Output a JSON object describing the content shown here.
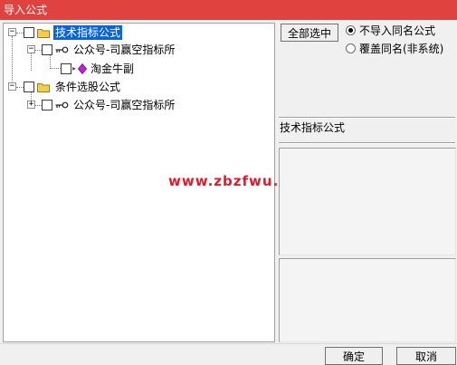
{
  "window": {
    "title": "导入公式"
  },
  "tree": {
    "groups": [
      {
        "label": "技术指标公式",
        "expander": "−",
        "selected": true,
        "children": [
          {
            "label": "公众号-司赢空指标所",
            "expander": "−",
            "icon": "key-icon",
            "children": [
              {
                "label": "淘金牛副",
                "icon": "diamond-icon"
              }
            ]
          }
        ]
      },
      {
        "label": "条件选股公式",
        "expander": "−",
        "selected": false,
        "children": [
          {
            "label": "公众号-司赢空指标所",
            "expander": "+",
            "icon": "key-icon"
          }
        ]
      }
    ]
  },
  "right_panel": {
    "select_all_label": "全部选中",
    "radio_options": [
      {
        "label": "不导入同名公式",
        "checked": true
      },
      {
        "label": "覆盖同名(非系统)",
        "checked": false
      }
    ],
    "formula_name": "技术指标公式"
  },
  "buttons": {
    "ok_label": "确定",
    "cancel_label": "取消"
  },
  "watermark": "www.zbzfwu.com",
  "colors": {
    "titlebar": "#e0423f",
    "selection": "#0a64d6",
    "watermark": "#e5192a",
    "folder": "#f2cd4f",
    "diamond": "#c21fd8"
  }
}
